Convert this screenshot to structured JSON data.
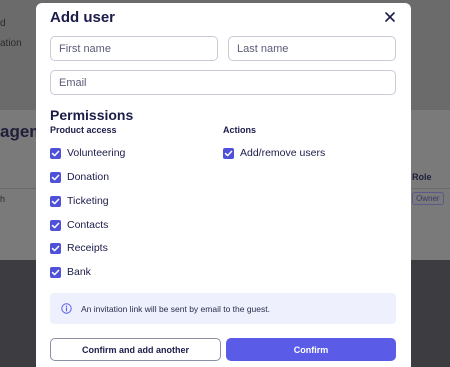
{
  "background": {
    "line1": "d",
    "line2": "ation",
    "card_title": "agem",
    "role_header": "Role",
    "row_name": "h",
    "row_role_badge": "Owner"
  },
  "modal": {
    "title": "Add user",
    "close_icon": "close-icon",
    "fields": {
      "first_name": {
        "placeholder": "First name",
        "value": ""
      },
      "last_name": {
        "placeholder": "Last name",
        "value": ""
      },
      "email": {
        "placeholder": "Email",
        "value": ""
      }
    },
    "permissions": {
      "title": "Permissions",
      "product_access": {
        "heading": "Product access",
        "items": [
          {
            "label": "Volunteering",
            "checked": true
          },
          {
            "label": "Donation",
            "checked": true
          },
          {
            "label": "Ticketing",
            "checked": true
          },
          {
            "label": "Contacts",
            "checked": true
          },
          {
            "label": "Receipts",
            "checked": true
          },
          {
            "label": "Bank",
            "checked": true
          }
        ]
      },
      "actions": {
        "heading": "Actions",
        "items": [
          {
            "label": "Add/remove users",
            "checked": true
          }
        ]
      }
    },
    "info": {
      "icon": "info-icon",
      "text": "An invitation link will be sent by email to the guest."
    },
    "buttons": {
      "secondary": "Confirm and add another",
      "primary": "Confirm"
    }
  },
  "colors": {
    "accent": "#5a5ce8",
    "checkbox": "#4f52d9",
    "text_dark": "#1c1c4a",
    "info_bg": "#eff0fd"
  }
}
